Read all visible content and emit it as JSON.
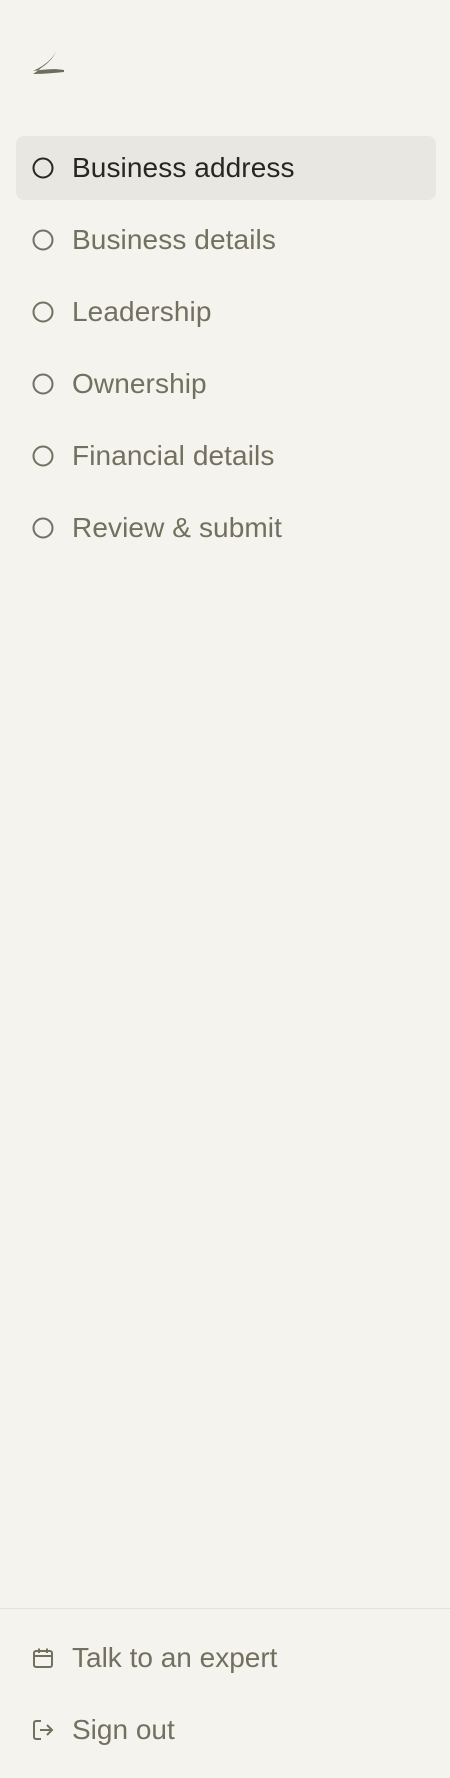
{
  "brand": {
    "logo_icon": "bird-wing-logo-icon",
    "logo_color": "#6E6C5E"
  },
  "steps": [
    {
      "label": "Business address",
      "icon": "circle-outline-icon",
      "active": true
    },
    {
      "label": "Business details",
      "icon": "circle-outline-icon",
      "active": false
    },
    {
      "label": "Leadership",
      "icon": "circle-outline-icon",
      "active": false
    },
    {
      "label": "Ownership",
      "icon": "circle-outline-icon",
      "active": false
    },
    {
      "label": "Financial details",
      "icon": "circle-outline-icon",
      "active": false
    },
    {
      "label": "Review & submit",
      "icon": "circle-outline-icon",
      "active": false
    }
  ],
  "footer": {
    "talk_to_expert": {
      "label": "Talk to an expert",
      "icon": "calendar-icon"
    },
    "sign_out": {
      "label": "Sign out",
      "icon": "sign-out-icon"
    }
  },
  "colors": {
    "background": "#F4F3EE",
    "active_background": "#E8E7E2",
    "active_text": "#262624",
    "muted_text": "#72705F"
  }
}
